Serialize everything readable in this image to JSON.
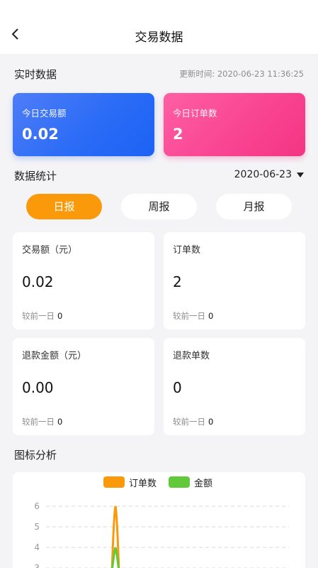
{
  "header": {
    "title": "交易数据",
    "back_icon": "chevron-left-icon"
  },
  "realtime": {
    "title": "实时数据",
    "update_time": "更新时间: 2020-06-23 11:36:25",
    "cards": [
      {
        "label": "今日交易额",
        "value": "0.02",
        "color": "#2b6cf6"
      },
      {
        "label": "今日订单数",
        "value": "2",
        "color": "#f33583"
      }
    ]
  },
  "stats": {
    "title": "数据统计",
    "date": "2020-06-23",
    "tabs": [
      {
        "label": "日报",
        "active": true
      },
      {
        "label": "周报",
        "active": false
      },
      {
        "label": "月报",
        "active": false
      }
    ],
    "cards": [
      {
        "label": "交易额（元）",
        "value": "0.02",
        "compare_label": "较前一日",
        "compare_value": "0"
      },
      {
        "label": "订单数",
        "value": "2",
        "compare_label": "较前一日",
        "compare_value": "0"
      },
      {
        "label": "退款金额（元）",
        "value": "0.00",
        "compare_label": "较前一日",
        "compare_value": "0"
      },
      {
        "label": "退款单数",
        "value": "0",
        "compare_label": "较前一日",
        "compare_value": "0"
      }
    ]
  },
  "chart_section": {
    "title": "图标分析"
  },
  "chart_data": {
    "type": "line",
    "series": [
      {
        "name": "订单数",
        "color": "#fa9a0b",
        "peak": 6
      },
      {
        "name": "金额",
        "color": "#62c93a",
        "peak": 4
      }
    ],
    "yticks": [
      "6",
      "5",
      "4",
      "3"
    ],
    "ylim": [
      0,
      6
    ],
    "grid": true,
    "legend": "top-center"
  },
  "colors": {
    "accent": "#fa9a0b",
    "blue": "#2b6cf6",
    "pink": "#f33583"
  }
}
